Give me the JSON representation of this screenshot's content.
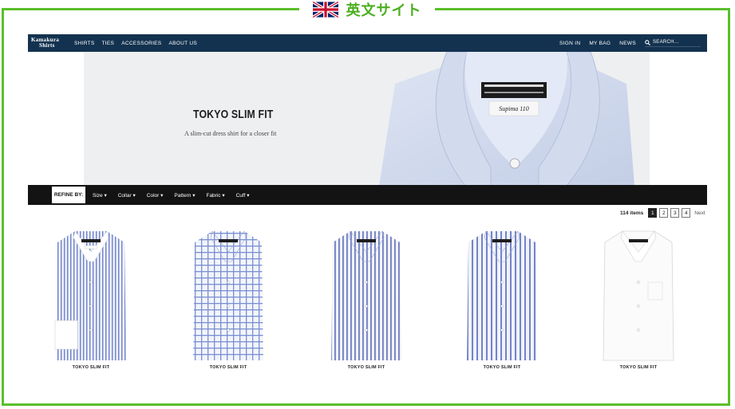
{
  "frame_title": "英文サイト",
  "colors": {
    "frame": "#5bbf2a",
    "nav_bg": "#13324f",
    "filter_bg": "#131313"
  },
  "nav": {
    "logo": [
      "Kamakura",
      "Shirts"
    ],
    "links": [
      "SHIRTS",
      "TIES",
      "ACCESSORIES",
      "ABOUT US"
    ],
    "right_links": [
      "SIGN IN",
      "MY BAG",
      "NEWS"
    ],
    "search_placeholder": "Search...",
    "search_icon": "search-icon"
  },
  "hero": {
    "title": "TOKYO SLIM FIT",
    "subtitle": "A slim-cut dress shirt for a closer fit",
    "label_text": "Supima 110"
  },
  "filter": {
    "refine_label": "REFINE BY:",
    "options": [
      "Size",
      "Collar",
      "Color",
      "Pattern",
      "Fabric",
      "Cuff"
    ]
  },
  "pagination": {
    "count": "114 items",
    "pages": [
      "1",
      "2",
      "3",
      "4"
    ],
    "current": "1",
    "next": "Next"
  },
  "products": [
    {
      "name": "TOKYO SLIM FIT",
      "pattern": "stripe-white-collar"
    },
    {
      "name": "TOKYO SLIM FIT",
      "pattern": "check"
    },
    {
      "name": "TOKYO SLIM FIT",
      "pattern": "stripe"
    },
    {
      "name": "TOKYO SLIM FIT",
      "pattern": "stripe"
    },
    {
      "name": "TOKYO SLIM FIT",
      "pattern": "white"
    }
  ]
}
